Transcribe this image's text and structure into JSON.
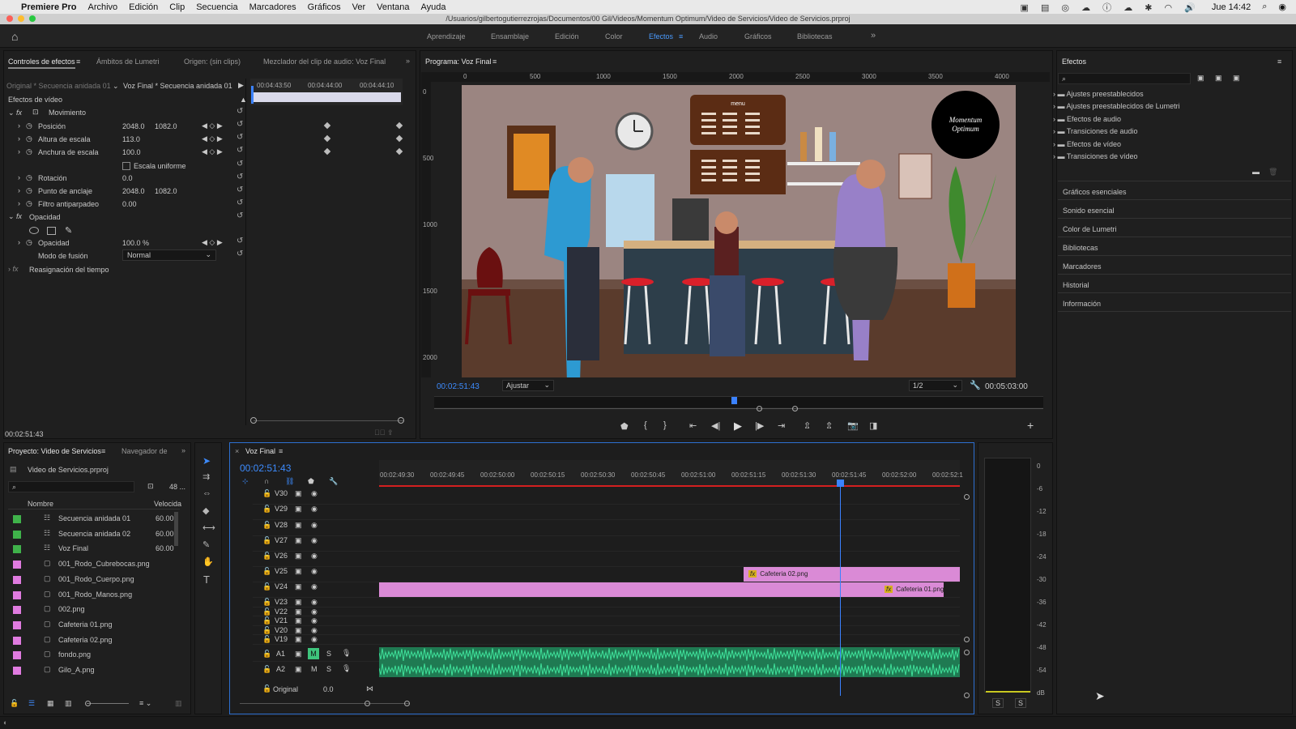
{
  "menubar": {
    "app": "Premiere Pro",
    "items": [
      "Archivo",
      "Edición",
      "Clip",
      "Secuencia",
      "Marcadores",
      "Gráficos",
      "Ver",
      "Ventana",
      "Ayuda"
    ],
    "clock": "Jue 14:42"
  },
  "title": "/Usuarios/gilbertogutierrezrojas/Documentos/00 Gil/Videos/Momentum Optimum/Video de Servicios/Video de Servicios.prproj",
  "workspaces": [
    "Aprendizaje",
    "Ensamblaje",
    "Edición",
    "Color",
    "Efectos",
    "Audio",
    "Gráficos",
    "Bibliotecas"
  ],
  "effect_controls": {
    "tabs": [
      "Controles de efectos",
      "Ámbitos de Lumetri",
      "Origen: (sin clips)",
      "Mezclador del clip de audio: Voz Final"
    ],
    "source": "Original * Secuencia anidada 01",
    "seq": "Voz Final * Secuencia anidada 01",
    "times": [
      "00:04:43:50",
      "00:04:44:00",
      "00:04:44:10"
    ],
    "video_effects": "Efectos de vídeo",
    "motion": "Movimiento",
    "position": {
      "label": "Posición",
      "x": "2048.0",
      "y": "1082.0"
    },
    "scale_h": {
      "label": "Altura de escala",
      "v": "113.0"
    },
    "scale_w": {
      "label": "Anchura de escala",
      "v": "100.0"
    },
    "uniform": "Escala uniforme",
    "rotation": {
      "label": "Rotación",
      "v": "0.0"
    },
    "anchor": {
      "label": "Punto de anclaje",
      "x": "2048.0",
      "y": "1082.0"
    },
    "flicker": {
      "label": "Filtro antiparpadeo",
      "v": "0.00"
    },
    "opacity_group": "Opacidad",
    "opacity": {
      "label": "Opacidad",
      "v": "100.0 %"
    },
    "blend": {
      "label": "Modo de fusión",
      "v": "Normal"
    },
    "remap": "Reasignación del tiempo",
    "timecode": "00:02:51:43"
  },
  "program": {
    "tab": "Programa: Voz Final",
    "ruler": [
      "0",
      "500",
      "1000",
      "1500",
      "2000",
      "2500",
      "3000",
      "3500",
      "4000"
    ],
    "vruler": [
      "0",
      "500",
      "1000",
      "1500",
      "2000"
    ],
    "timecode": "00:02:51:43",
    "fit": "Ajustar",
    "res": "1/2",
    "duration": "00:05:03:00",
    "scene": {
      "menu": "menu",
      "logo1": "Momentum",
      "logo2": "Optimum"
    }
  },
  "effects_panel": {
    "title": "Efectos",
    "folders": [
      "Ajustes preestablecidos",
      "Ajustes preestablecidos de Lumetri",
      "Efectos de audio",
      "Transiciones de audio",
      "Efectos de vídeo",
      "Transiciones de vídeo"
    ],
    "sections": [
      "Gráficos esenciales",
      "Sonido esencial",
      "Color de Lumetri",
      "Bibliotecas",
      "Marcadores",
      "Historial",
      "Información"
    ]
  },
  "project": {
    "tabs": [
      "Proyecto: Video de Servicios",
      "Navegador de"
    ],
    "file": "Video de Servicios.prproj",
    "count": "48 ...",
    "col_name": "Nombre",
    "col_speed": "Velocida",
    "items": [
      {
        "name": "Secuencia anidada 01",
        "speed": "60.00",
        "color": "#3fb24a",
        "kind": "seq"
      },
      {
        "name": "Secuencia anidada 02",
        "speed": "60.00",
        "color": "#3fb24a",
        "kind": "seq"
      },
      {
        "name": "Voz Final",
        "speed": "60.00",
        "color": "#3fb24a",
        "kind": "seq"
      },
      {
        "name": "001_Rodo_Cubrebocas.png",
        "speed": "",
        "color": "#e07be0",
        "kind": "img"
      },
      {
        "name": "001_Rodo_Cuerpo.png",
        "speed": "",
        "color": "#e07be0",
        "kind": "img"
      },
      {
        "name": "001_Rodo_Manos.png",
        "speed": "",
        "color": "#e07be0",
        "kind": "img"
      },
      {
        "name": "002.png",
        "speed": "",
        "color": "#e07be0",
        "kind": "img"
      },
      {
        "name": "Cafeteria 01.png",
        "speed": "",
        "color": "#e07be0",
        "kind": "img"
      },
      {
        "name": "Cafeteria 02.png",
        "speed": "",
        "color": "#e07be0",
        "kind": "img"
      },
      {
        "name": "fondo.png",
        "speed": "",
        "color": "#e07be0",
        "kind": "img"
      },
      {
        "name": "Gilo_A.png",
        "speed": "",
        "color": "#e07be0",
        "kind": "img"
      }
    ]
  },
  "timeline": {
    "tab": "Voz Final",
    "timecode": "00:02:51:43",
    "ticks": [
      "00:02:49:30",
      "00:02:49:45",
      "00:02:50:00",
      "00:02:50:15",
      "00:02:50:30",
      "00:02:50:45",
      "00:02:51:00",
      "00:02:51:15",
      "00:02:51:30",
      "00:02:51:45",
      "00:02:52:00",
      "00:02:52:1"
    ],
    "tracks": [
      "V30",
      "V29",
      "V28",
      "V27",
      "V26",
      "V25",
      "V24",
      "V23",
      "V22",
      "V21",
      "V20",
      "V19"
    ],
    "audio": [
      "A1",
      "A2"
    ],
    "m": "M",
    "s": "S",
    "original": "Original",
    "original_val": "0.0",
    "clips": {
      "c2": "Cafeteria 02.png",
      "c1": "Cafeteria 01.png"
    }
  },
  "meter": {
    "scale": [
      "0",
      "-6",
      "-12",
      "-18",
      "-24",
      "-30",
      "-36",
      "-42",
      "-48",
      "-54",
      "dB"
    ],
    "s": "S"
  }
}
